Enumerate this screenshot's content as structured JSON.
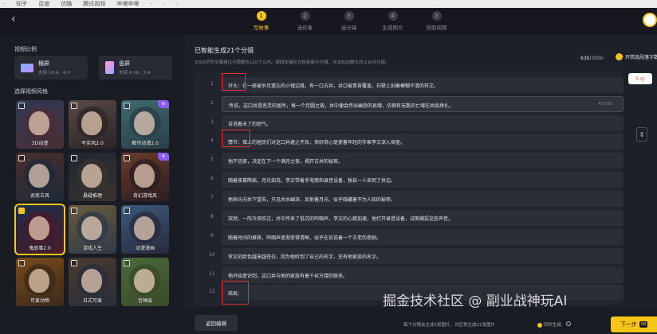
{
  "bookmarks": [
    "·",
    "知乎",
    "百度",
    "优酷",
    "腾讯视频",
    "哔哩哔哩",
    "·",
    "·",
    "·"
  ],
  "steps": [
    {
      "num": "1",
      "label": "写故事",
      "active": true
    },
    {
      "num": "2",
      "label": "选形象",
      "active": false
    },
    {
      "num": "3",
      "label": "选分镜",
      "active": false
    },
    {
      "num": "4",
      "label": "生成图片",
      "active": false
    },
    {
      "num": "5",
      "label": "获取视频",
      "active": false
    }
  ],
  "left": {
    "ratio_title": "视频比例",
    "ratios": [
      {
        "name": "横屏",
        "hint": "支持 16:9、4:3"
      },
      {
        "name": "竖屏",
        "hint": "支持 9:16、3:4"
      }
    ],
    "style_title": "选择视频风格",
    "styles": [
      {
        "name": "3D动漫",
        "selected": false,
        "vip": false,
        "c1": "#2d3a55",
        "c2": "#4b2f35"
      },
      {
        "name": "写实风2.0",
        "selected": false,
        "vip": false,
        "c1": "#5a4a48",
        "c2": "#2b2426"
      },
      {
        "name": "都市动漫2.0",
        "selected": false,
        "vip": true,
        "c1": "#3e6b6f",
        "c2": "#2a3e48"
      },
      {
        "name": "武侠古风",
        "selected": false,
        "vip": false,
        "c1": "#4a2f2a",
        "c2": "#1e2a3a"
      },
      {
        "name": "悬疑推理",
        "selected": false,
        "vip": false,
        "c1": "#1e2630",
        "c2": "#3a3330"
      },
      {
        "name": "奇幻游戏风",
        "selected": false,
        "vip": true,
        "c1": "#6a3a2a",
        "c2": "#2a1e22"
      },
      {
        "name": "鬼故事2.0",
        "selected": true,
        "vip": false,
        "c1": "#1a2e4a",
        "c2": "#4a1a2a"
      },
      {
        "name": "游戏人生",
        "selected": false,
        "vip": false,
        "c1": "#6a5a3a",
        "c2": "#2e3a4a"
      },
      {
        "name": "动漫漫画",
        "selected": false,
        "vip": false,
        "c1": "#3a5a7a",
        "c2": "#2a2a3e"
      },
      {
        "name": "可爱动物",
        "selected": false,
        "vip": false,
        "c1": "#7a4a1a",
        "c2": "#3a2a1a"
      },
      {
        "name": "日式可爱",
        "selected": false,
        "vip": false,
        "c1": "#4a3a2e",
        "c2": "#2a2e3a"
      },
      {
        "name": "宫崎骏",
        "selected": false,
        "vip": false,
        "c1": "#4a6a3a",
        "c2": "#3a4a2a"
      }
    ]
  },
  "main": {
    "title": "已智能生成21个分镜",
    "subtitle": "3000字的文案建议分镜数在120个以内。按回车键在光标处新分分镜，点击右边删头向上合并分镜。",
    "count_current": "630",
    "count_total": "/3000",
    "toggle_label": "开禁选段落字数",
    "scenes": [
      {
        "idx": "1",
        "text": "开头：在一座被岁月遗忘的小镇边缘，有一口古井，井口被青苔覆盖，石壁上刻着模糊不清的符文。"
      },
      {
        "idx": "2",
        "text": "传说，这口井是恶灵的居所，每一个月圆之夜，井中便会传出幽怨的哀嚎，仿佛有无数的亡魂在井底挣扎。",
        "meta": "47/100"
      },
      {
        "idx": "3",
        "text": "诉说着未了的怨气。"
      },
      {
        "idx": "4",
        "text": "情节：镇上的居民们对这口井避之不及，但好奇心驱使着年轻的作家李文深入探查。"
      },
      {
        "idx": "5",
        "text": "他不信邪，决定在下一个满月之夜，揭开古井的秘密。"
      },
      {
        "idx": "6",
        "text": "随着夜幕降临，月光如洗，李文带着手电筒和录音设备，独自一人来到了井边。"
      },
      {
        "idx": "7",
        "text": "他探头向井下望去，只见井水幽深，反射着月光，似乎隐藏着不为人知的秘密。"
      },
      {
        "idx": "8",
        "text": "突然，一阵冷风吹过，井中传来了低沉的呜咽声，李文的心跳加速，他打开录音设备，试图捕捉这些声音。"
      },
      {
        "idx": "9",
        "text": "随着时间的推移，呜咽声逐渐变得清晰，似乎在诉说着一个古老的悲剧。"
      },
      {
        "idx": "10",
        "text": "李文的脸色越来越苍白，因为他听到了自己的名字，还有他家族的名字。"
      },
      {
        "idx": "11",
        "text": "他开始意识到，这口井与他的家族有着千丝万缕的联系。"
      },
      {
        "idx": "12",
        "text": "结局："
      }
    ]
  },
  "sidebar_widget": {
    "sogou": "S",
    "lang": "中"
  },
  "bottom": {
    "back_label": "返回编辑",
    "watermark": "掘金技术社区 @ 副业战神玩AI",
    "info": "每个分镜会生成1张图片，对应将生成21张图片",
    "opt1": "同时生成",
    "opt2": "",
    "next_label": "下一步",
    "next_badge": "99"
  },
  "colors": {
    "accent": "#f5c518",
    "highlight": "#e23232",
    "bg": "#1b1d25"
  }
}
